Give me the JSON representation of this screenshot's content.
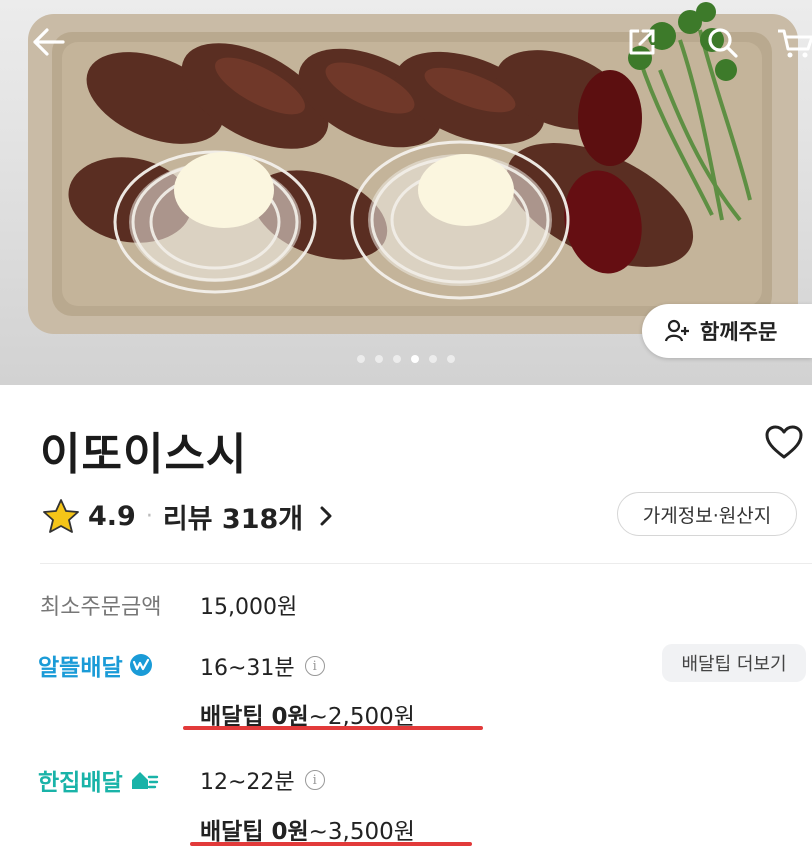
{
  "hero": {
    "carousel": {
      "count": 6,
      "active_index": 3
    },
    "group_order_label": "함께주문"
  },
  "store": {
    "name": "이또이스시",
    "rating": "4.9",
    "review_label": "리뷰 318개",
    "info_button": "가게정보·원산지"
  },
  "min_order": {
    "label": "최소주문금액",
    "value": "15,000원"
  },
  "delivery": [
    {
      "type": "알뜰배달",
      "time": "16~31분",
      "tip_prefix": "배달팁 0원",
      "tip_suffix": "~2,500원",
      "color": "#1a9bd7"
    },
    {
      "type": "한집배달",
      "time": "12~22분",
      "tip_prefix": "배달팁 0원",
      "tip_suffix": "~3,500원",
      "color": "#19b3a8"
    }
  ],
  "more_tip_button": "배달팁 더보기",
  "colors": {
    "annotation_underline": "#e23a3a",
    "star": "#f5c518"
  }
}
